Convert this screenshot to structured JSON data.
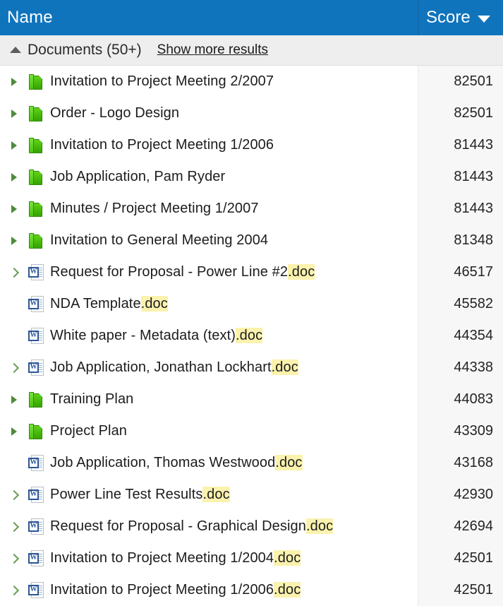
{
  "columns": {
    "name_label": "Name",
    "score_label": "Score",
    "sort_icon": "sort-descending-caret-icon",
    "header_bg": "#1074bc",
    "header_text_color": "#ffffff"
  },
  "group": {
    "caret_icon": "collapse-triangle-up-icon",
    "title": "Documents (50+)",
    "show_more_label": "Show more results"
  },
  "highlight_color": "#faf2ad",
  "rows": [
    {
      "expander": "expand-triangle-icon",
      "icon": "green-book-icon",
      "name": "Invitation to Project Meeting 2/2007",
      "highlight": "",
      "score": "82501"
    },
    {
      "expander": "expand-triangle-icon",
      "icon": "green-book-icon",
      "name": "Order - Logo Design",
      "highlight": "",
      "score": "82501"
    },
    {
      "expander": "expand-triangle-icon",
      "icon": "green-book-icon",
      "name": "Invitation to Project Meeting 1/2006",
      "highlight": "",
      "score": "81443"
    },
    {
      "expander": "expand-triangle-icon",
      "icon": "green-book-icon",
      "name": "Job Application, Pam Ryder",
      "highlight": "",
      "score": "81443"
    },
    {
      "expander": "expand-triangle-icon",
      "icon": "green-book-icon",
      "name": "Minutes / Project Meeting 1/2007",
      "highlight": "",
      "score": "81443"
    },
    {
      "expander": "expand-triangle-icon",
      "icon": "green-book-icon",
      "name": "Invitation to General Meeting 2004",
      "highlight": "",
      "score": "81348"
    },
    {
      "expander": "expand-chevron-icon",
      "icon": "word-document-icon",
      "name": "Request for Proposal - Power Line #2",
      "highlight": ".doc",
      "score": "46517"
    },
    {
      "expander": "none",
      "icon": "word-document-icon",
      "name": "NDA Template",
      "highlight": ".doc",
      "score": "45582"
    },
    {
      "expander": "none",
      "icon": "word-document-icon",
      "name": "White paper - Metadata (text)",
      "highlight": ".doc",
      "score": "44354"
    },
    {
      "expander": "expand-chevron-icon",
      "icon": "word-document-icon",
      "name": "Job Application, Jonathan Lockhart",
      "highlight": ".doc",
      "score": "44338"
    },
    {
      "expander": "expand-triangle-icon",
      "icon": "green-book-icon",
      "name": "Training Plan",
      "highlight": "",
      "score": "44083"
    },
    {
      "expander": "expand-triangle-icon",
      "icon": "green-book-icon",
      "name": "Project Plan",
      "highlight": "",
      "score": "43309"
    },
    {
      "expander": "none",
      "icon": "word-document-icon",
      "name": "Job Application, Thomas Westwood",
      "highlight": ".doc",
      "score": "43168"
    },
    {
      "expander": "expand-chevron-icon",
      "icon": "word-document-icon",
      "name": "Power Line Test Results",
      "highlight": ".doc",
      "score": "42930"
    },
    {
      "expander": "expand-chevron-icon",
      "icon": "word-document-icon",
      "name": "Request for Proposal - Graphical Design",
      "highlight": ".doc",
      "score": "42694"
    },
    {
      "expander": "expand-chevron-icon",
      "icon": "word-document-icon",
      "name": "Invitation to Project Meeting 1/2004",
      "highlight": ".doc",
      "score": "42501"
    },
    {
      "expander": "expand-chevron-icon",
      "icon": "word-document-icon",
      "name": "Invitation to Project Meeting 1/2006",
      "highlight": ".doc",
      "score": "42501"
    }
  ]
}
